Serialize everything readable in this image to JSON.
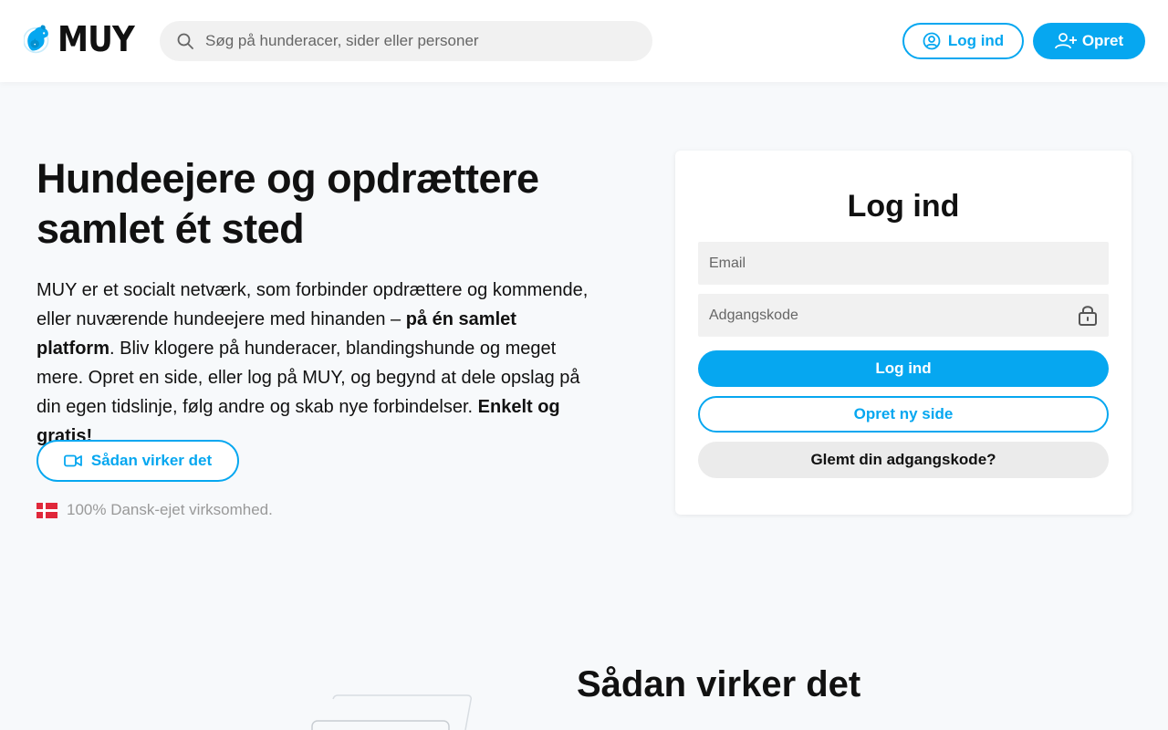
{
  "header": {
    "logo_text": "MUY",
    "search_placeholder": "Søg på hunderacer, sider eller personer",
    "login_label": "Log ind",
    "create_label": "Opret"
  },
  "hero": {
    "title": "Hundeejere og opdrættere samlet ét sted",
    "text_1": "MUY er et socialt netværk, som forbinder opdrættere og kommende, eller nuværende hundeejere med hinanden – ",
    "text_bold_1": "på én samlet platform",
    "text_2": ". Bliv klogere på hunderacer, blandingshunde og meget mere. Opret en side, eller log på MUY, og begynd at dele opslag på din egen tidslinje, følg andre og skab nye forbindelser. ",
    "text_bold_2": "Enkelt og gratis!",
    "how_button": "Sådan virker det",
    "danish_note": "100% Dansk-ejet virksomhed."
  },
  "login_card": {
    "title": "Log ind",
    "email_placeholder": "Email",
    "password_placeholder": "Adgangskode",
    "login_button": "Log ind",
    "create_button": "Opret ny side",
    "forgot_button": "Glemt din adgangskode?"
  },
  "how_section": {
    "title": "Sådan virker det"
  },
  "colors": {
    "accent": "#06a7f0",
    "background": "#f7f9fb",
    "flag_red": "#e0283a"
  }
}
